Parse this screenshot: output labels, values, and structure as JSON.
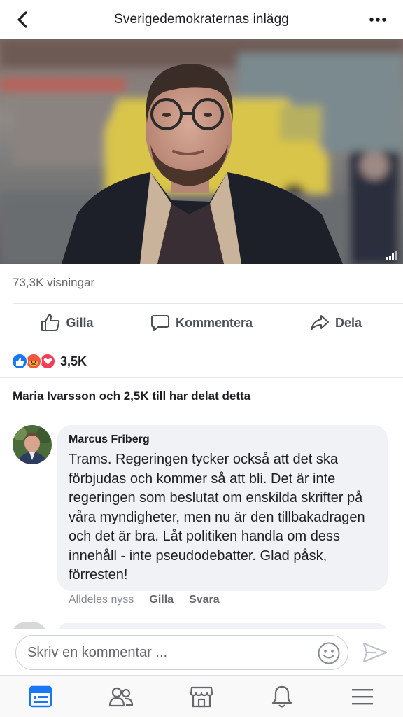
{
  "header": {
    "title": "Sverigedemokraternas inlägg",
    "back_icon": "chevron-left-icon",
    "more_icon": "more-horizontal-icon"
  },
  "video": {
    "corner_icon": "video-quality-icon"
  },
  "stats": {
    "views": "73,3K visningar"
  },
  "actions": [
    {
      "label": "Gilla",
      "icon": "like-icon"
    },
    {
      "label": "Kommentera",
      "icon": "comment-icon"
    },
    {
      "label": "Dela",
      "icon": "share-icon"
    }
  ],
  "reactions": {
    "icons": [
      "like-reaction-icon",
      "angry-reaction-icon",
      "love-reaction-icon"
    ],
    "count": "3,5K",
    "colors": {
      "like": "#1877f2",
      "angry": "#f0563d",
      "love": "#f33e58"
    }
  },
  "shares": {
    "text": "Maria Ivarsson och 2,5K till har delat detta"
  },
  "comment": {
    "author": "Marcus Friberg",
    "text": "Trams. Regeringen tycker också att det ska förbjudas och kommer så att bli. Det är inte regeringen som beslutat om enskilda skrifter på våra myndigheter, men nu är den tillbakadragen och det är bra. Låt politiken handla om dess innehåll - inte pseudodebatter. Glad påsk, förresten!",
    "time": "Alldeles nyss",
    "like_label": "Gilla",
    "reply_label": "Svara"
  },
  "composer": {
    "placeholder": "Skriv en kommentar ...",
    "emoji_icon": "emoji-icon",
    "send_icon": "send-icon"
  },
  "bottom_nav": [
    {
      "icon": "news-feed-icon",
      "active": true
    },
    {
      "icon": "friends-icon",
      "active": false
    },
    {
      "icon": "marketplace-icon",
      "active": false
    },
    {
      "icon": "notifications-icon",
      "active": false
    },
    {
      "icon": "menu-icon",
      "active": false
    }
  ],
  "colors": {
    "accent": "#1877f2",
    "text": "#1c1e21",
    "secondary_text": "#65676b",
    "bubble": "#f0f2f5",
    "divider": "#e4e6eb"
  }
}
